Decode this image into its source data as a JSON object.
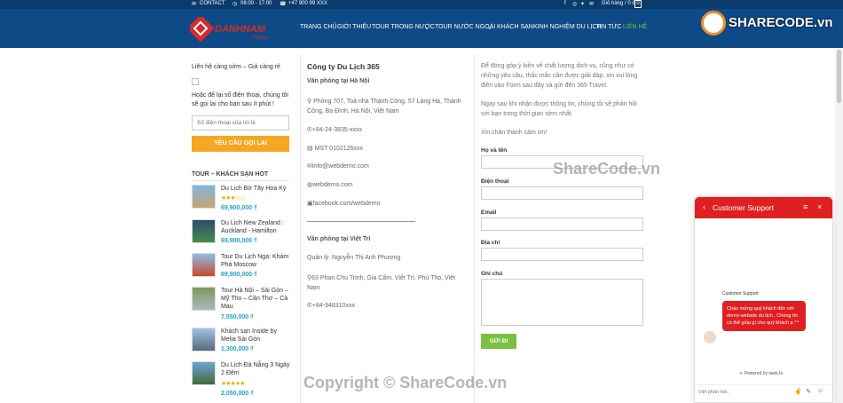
{
  "topbar": {
    "contact": "CONTACT",
    "hours": "08:00 - 17:00",
    "phone": "+47 900 99 XXX",
    "cart": "Giỏ hàng / 0 đ",
    "cart_count": "0"
  },
  "nav": {
    "items": [
      "TRANG CHỦ",
      "GIỚI THIỆU",
      "TOUR TRONG NƯỚC",
      "TOUR NƯỚC NGOÀI",
      "KHÁCH SẠN",
      "KINH NGHIỆM DU LỊCH",
      "TIN TỨC",
      "LIÊN HỆ"
    ]
  },
  "brand": {
    "logo_text": "DANHNAM",
    "logo_sub": "TRAVEL",
    "watermark_logo": "SHARECODE.vn"
  },
  "callback": {
    "heading": "Liên hệ càng sớm – Giá càng rẻ",
    "text": "Hoặc để lại số điện thoại, chúng tôi sẽ gọi lại cho bạn sau ít phút !",
    "placeholder": "Số điện thoại của tôi là",
    "button": "YÊU CẦU GỌI LẠI"
  },
  "sidebar": {
    "title": "TOUR – KHÁCH SẠN HOT",
    "products": [
      {
        "name": "Du Lịch Bờ Tây Hoa Kỳ",
        "price": "69,900,000 ₫",
        "stars": "★★★☆☆",
        "rating": 3
      },
      {
        "name": "Du Lịch New Zealand : Auckland - Hamilton",
        "price": "69,900,000 ₫",
        "stars": "",
        "rating": 0
      },
      {
        "name": "Tour Du Lịch Nga: Khám Phá Moscow",
        "price": "69,900,000 ₫",
        "stars": "",
        "rating": 0
      },
      {
        "name": "Tour Hà Nội – Sài Gòn – Mỹ Tho – Cần Thơ – Cà Mau",
        "price": "7,550,000 ₫",
        "stars": "",
        "rating": 0
      },
      {
        "name": "Khách sạn Inside by Melia Sài Gòn",
        "price": "1,300,000 ₫",
        "stars": "",
        "rating": 0
      },
      {
        "name": "Du Lịch Đà Nẵng 3 Ngày 2 Đêm",
        "price": "2,050,000 ₫",
        "stars": "★★★★★",
        "rating": 5
      }
    ]
  },
  "company": {
    "name": "Công ty Du Lịch 365",
    "hanoi_title": "Văn phòng tại Hà Nội",
    "hanoi_address": "Phòng 707, Toà nhà Thành Công, 57 Láng Hạ, Thành Công, Ba Đình, Hà Nội, Việt Nam",
    "hanoi_phone": "+84-24-3835-xxxx",
    "tax": "MST 0102126xxx",
    "email": "info@webdemo.com",
    "website": "webdemo.com",
    "facebook": "facebook.com/webdemo",
    "viettri_title": "Văn phòng tại Việt Trì",
    "manager": "Quản lý: Nguyễn Thị Anh Phương",
    "viettri_address": "63 Phan Chu Trinh, Gia Cẩm, Việt Trì, Phú Thọ, Việt Nam",
    "viettri_phone": "+84-948310xxx"
  },
  "form": {
    "intro1": "Để đóng góp ý kiến về chất lượng dịch vụ, cũng như có những yêu cầu, thắc mắc cần được giải đáp, xin vui lòng điền vào Form sau đây và gửi đến 365 Travel.",
    "intro2": "Ngay sau khi nhận được thông tin, chúng tôi sẽ phản hồi với bạn trong thời gian sớm nhất.",
    "intro3": "Xin chân thành cảm ơn!",
    "name_label": "Họ và tên",
    "phone_label": "Điện thoại",
    "email_label": "Email",
    "address_label": "Địa chỉ",
    "note_label": "Ghi chú",
    "submit": "GỬI ĐI"
  },
  "chat": {
    "title": "Customer Support",
    "sender": "Customer Support",
    "message": "Chào mừng quý khách đến với demo-website du lịch . Chúng tôi có thể giúp gì cho quý khách ạ ^^",
    "powered": "Powered by tawk.to",
    "input_placeholder": "Viết phản hồi..",
    "accent": "#e02020"
  },
  "watermarks": {
    "middle": "ShareCode.vn",
    "bottom": "Copyright © ShareCode.vn"
  },
  "colors": {
    "header_bg": "#0d4a86",
    "topbar_bg": "#0a3b6c",
    "orange": "#f5a623",
    "green": "#7ac142",
    "price": "#21a3c4"
  }
}
